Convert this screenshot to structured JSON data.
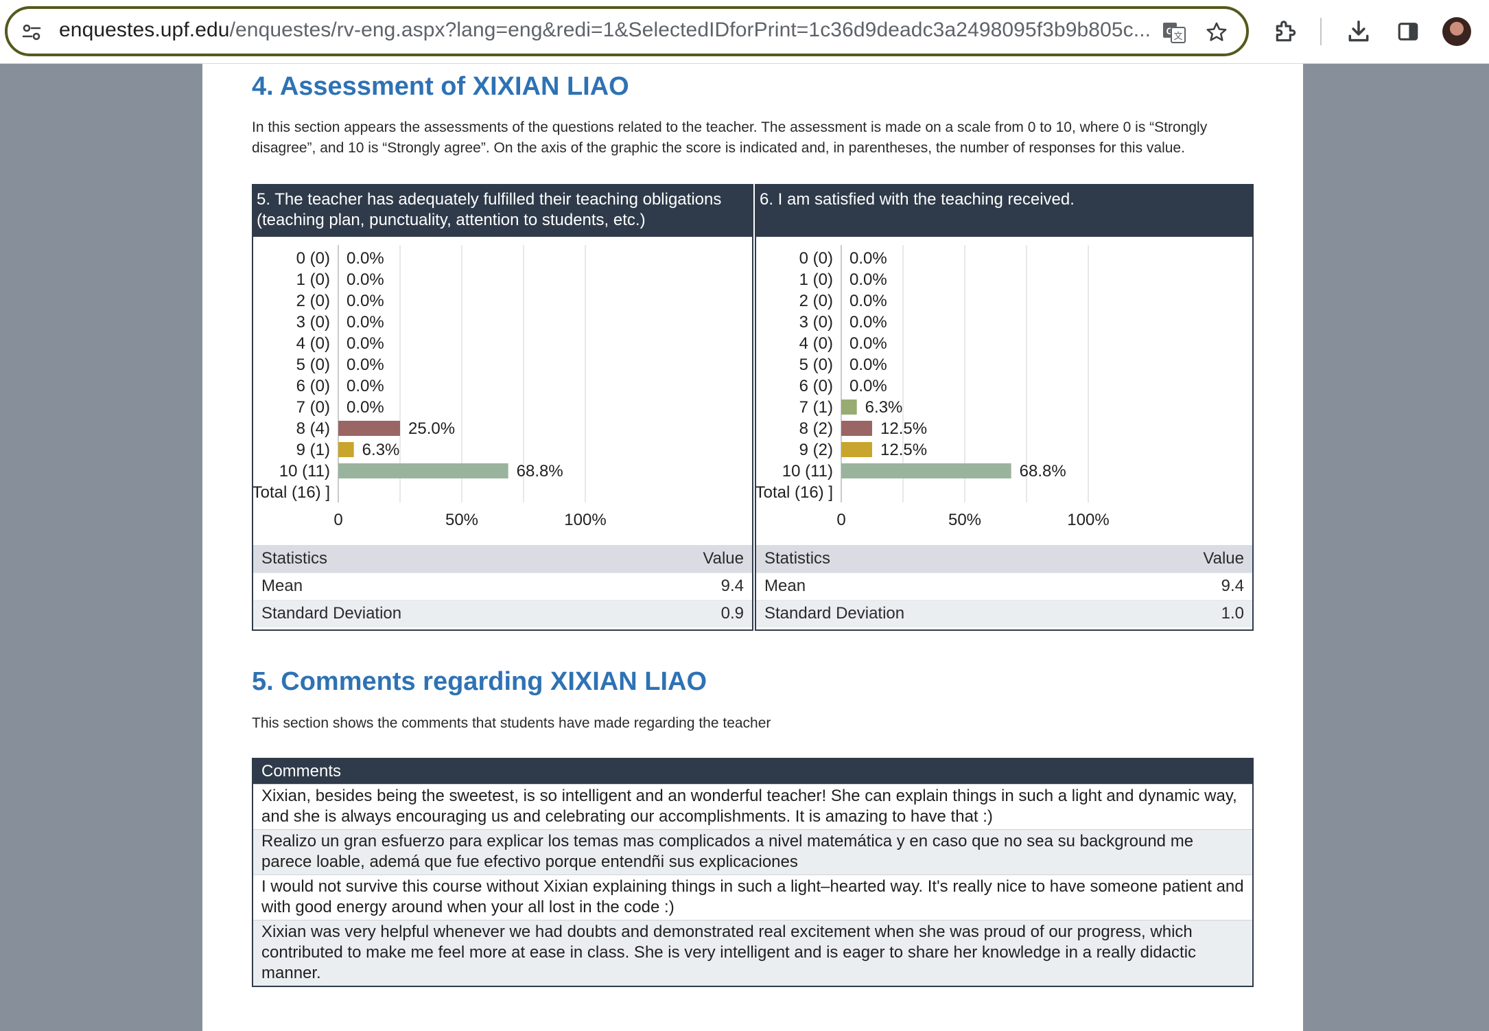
{
  "browser": {
    "url_host": "enquestes.upf.edu",
    "url_path": "/enquestes/rv-eng.aspx?lang=eng&redi=1&SelectedIDforPrint=1c36d9deadc3a2498095f3b9b805c..."
  },
  "assessment": {
    "title": "4. Assessment of XIXIAN LIAO",
    "description": "In this section appears the assessments of the questions related to the teacher. The assessment is made on a scale from 0 to 10, where 0 is “Strongly disagree”, and 10 is “Strongly agree”. On the axis of the graphic the score is indicated and, in parentheses, the number of responses for this value."
  },
  "chart_data": [
    {
      "type": "bar",
      "orientation": "horizontal",
      "title": "5. The teacher has adequately fulfilled their teaching obligations (teaching plan, punctuality, attention to students, etc.)",
      "categories": [
        "0 (0)",
        "1 (0)",
        "2 (0)",
        "3 (0)",
        "4 (0)",
        "5 (0)",
        "6 (0)",
        "7 (0)",
        "8 (4)",
        "9 (1)",
        "10 (11)",
        "[ Total (16) ]"
      ],
      "values": [
        0,
        0,
        0,
        0,
        0,
        0,
        0,
        0,
        25.0,
        6.3,
        68.8,
        null
      ],
      "value_labels": [
        "0.0%",
        "0.0%",
        "0.0%",
        "0.0%",
        "0.0%",
        "0.0%",
        "0.0%",
        "0.0%",
        "25.0%",
        "6.3%",
        "68.8%",
        ""
      ],
      "colors": [
        "#98ab72",
        "#98ab72",
        "#98ab72",
        "#98ab72",
        "#98ab72",
        "#98ab72",
        "#98ab72",
        "#98ab72",
        "#9a6565",
        "#c8a52c",
        "#9ab39d",
        "#9ab39d"
      ],
      "xlim": [
        0,
        100
      ],
      "xticks": [
        "0",
        "50%",
        "100%"
      ],
      "grid": true
    },
    {
      "type": "bar",
      "orientation": "horizontal",
      "title": "6. I am satisfied with the teaching received.",
      "categories": [
        "0 (0)",
        "1 (0)",
        "2 (0)",
        "3 (0)",
        "4 (0)",
        "5 (0)",
        "6 (0)",
        "7 (1)",
        "8 (2)",
        "9 (2)",
        "10 (11)",
        "[ Total (16) ]"
      ],
      "values": [
        0,
        0,
        0,
        0,
        0,
        0,
        0,
        6.3,
        12.5,
        12.5,
        68.8,
        null
      ],
      "value_labels": [
        "0.0%",
        "0.0%",
        "0.0%",
        "0.0%",
        "0.0%",
        "0.0%",
        "0.0%",
        "6.3%",
        "12.5%",
        "12.5%",
        "68.8%",
        ""
      ],
      "colors": [
        "#98ab72",
        "#98ab72",
        "#98ab72",
        "#98ab72",
        "#98ab72",
        "#98ab72",
        "#98ab72",
        "#98ab72",
        "#9a6565",
        "#c8a52c",
        "#9ab39d",
        "#9ab39d"
      ],
      "xlim": [
        0,
        100
      ],
      "xticks": [
        "0",
        "50%",
        "100%"
      ],
      "grid": true
    }
  ],
  "stats": [
    {
      "header_label": "Statistics",
      "header_value": "Value",
      "rows": [
        {
          "label": "Mean",
          "value": "9.4"
        },
        {
          "label": "Standard Deviation",
          "value": "0.9"
        }
      ]
    },
    {
      "header_label": "Statistics",
      "header_value": "Value",
      "rows": [
        {
          "label": "Mean",
          "value": "9.4"
        },
        {
          "label": "Standard Deviation",
          "value": "1.0"
        }
      ]
    }
  ],
  "comments_section": {
    "title": "5. Comments regarding XIXIAN LIAO",
    "description": "This section shows the comments that students have made regarding the teacher",
    "header": "Comments",
    "items": [
      "Xixian, besides being the sweetest, is so intelligent and an wonderful teacher! She can explain things in such a light and dynamic way, and she is always encouraging us and celebrating our accomplishments. It is amazing to have that :)",
      "Realizo un gran esfuerzo para explicar los temas mas complicados a nivel matemática y en caso que no sea su background me parece loable, ademá que fue efectivo porque entendñi sus explicaciones",
      "I would not survive this course without Xixian explaining things in such a light–hearted way. It's really nice to have someone patient and with good energy around when your all lost in the code :)",
      "Xixian was very helpful whenever we had doubts and demonstrated real excitement when she was proud of our progress, which contributed to make me feel more at ease in class. She is very intelligent and is eager to share her knowledge in a really didactic manner."
    ]
  }
}
